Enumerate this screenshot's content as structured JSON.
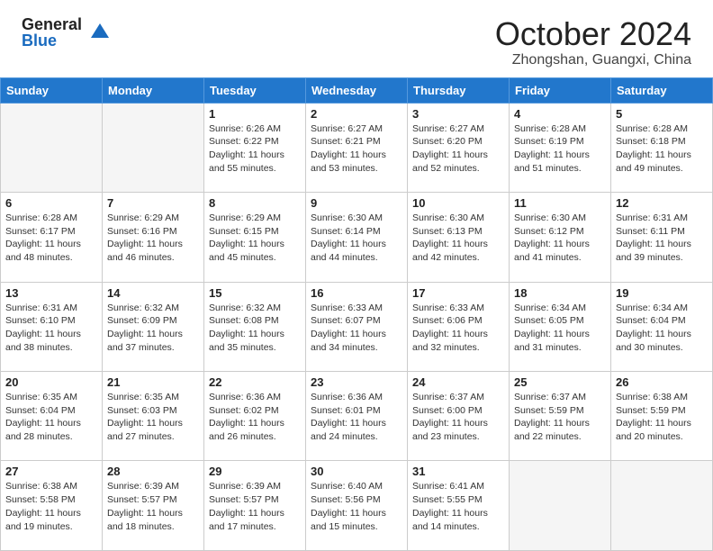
{
  "logo": {
    "general": "General",
    "blue": "Blue"
  },
  "header": {
    "month": "October 2024",
    "location": "Zhongshan, Guangxi, China"
  },
  "weekdays": [
    "Sunday",
    "Monday",
    "Tuesday",
    "Wednesday",
    "Thursday",
    "Friday",
    "Saturday"
  ],
  "weeks": [
    [
      {
        "day": "",
        "sunrise": "",
        "sunset": "",
        "daylight": ""
      },
      {
        "day": "",
        "sunrise": "",
        "sunset": "",
        "daylight": ""
      },
      {
        "day": "1",
        "sunrise": "Sunrise: 6:26 AM",
        "sunset": "Sunset: 6:22 PM",
        "daylight": "Daylight: 11 hours and 55 minutes."
      },
      {
        "day": "2",
        "sunrise": "Sunrise: 6:27 AM",
        "sunset": "Sunset: 6:21 PM",
        "daylight": "Daylight: 11 hours and 53 minutes."
      },
      {
        "day": "3",
        "sunrise": "Sunrise: 6:27 AM",
        "sunset": "Sunset: 6:20 PM",
        "daylight": "Daylight: 11 hours and 52 minutes."
      },
      {
        "day": "4",
        "sunrise": "Sunrise: 6:28 AM",
        "sunset": "Sunset: 6:19 PM",
        "daylight": "Daylight: 11 hours and 51 minutes."
      },
      {
        "day": "5",
        "sunrise": "Sunrise: 6:28 AM",
        "sunset": "Sunset: 6:18 PM",
        "daylight": "Daylight: 11 hours and 49 minutes."
      }
    ],
    [
      {
        "day": "6",
        "sunrise": "Sunrise: 6:28 AM",
        "sunset": "Sunset: 6:17 PM",
        "daylight": "Daylight: 11 hours and 48 minutes."
      },
      {
        "day": "7",
        "sunrise": "Sunrise: 6:29 AM",
        "sunset": "Sunset: 6:16 PM",
        "daylight": "Daylight: 11 hours and 46 minutes."
      },
      {
        "day": "8",
        "sunrise": "Sunrise: 6:29 AM",
        "sunset": "Sunset: 6:15 PM",
        "daylight": "Daylight: 11 hours and 45 minutes."
      },
      {
        "day": "9",
        "sunrise": "Sunrise: 6:30 AM",
        "sunset": "Sunset: 6:14 PM",
        "daylight": "Daylight: 11 hours and 44 minutes."
      },
      {
        "day": "10",
        "sunrise": "Sunrise: 6:30 AM",
        "sunset": "Sunset: 6:13 PM",
        "daylight": "Daylight: 11 hours and 42 minutes."
      },
      {
        "day": "11",
        "sunrise": "Sunrise: 6:30 AM",
        "sunset": "Sunset: 6:12 PM",
        "daylight": "Daylight: 11 hours and 41 minutes."
      },
      {
        "day": "12",
        "sunrise": "Sunrise: 6:31 AM",
        "sunset": "Sunset: 6:11 PM",
        "daylight": "Daylight: 11 hours and 39 minutes."
      }
    ],
    [
      {
        "day": "13",
        "sunrise": "Sunrise: 6:31 AM",
        "sunset": "Sunset: 6:10 PM",
        "daylight": "Daylight: 11 hours and 38 minutes."
      },
      {
        "day": "14",
        "sunrise": "Sunrise: 6:32 AM",
        "sunset": "Sunset: 6:09 PM",
        "daylight": "Daylight: 11 hours and 37 minutes."
      },
      {
        "day": "15",
        "sunrise": "Sunrise: 6:32 AM",
        "sunset": "Sunset: 6:08 PM",
        "daylight": "Daylight: 11 hours and 35 minutes."
      },
      {
        "day": "16",
        "sunrise": "Sunrise: 6:33 AM",
        "sunset": "Sunset: 6:07 PM",
        "daylight": "Daylight: 11 hours and 34 minutes."
      },
      {
        "day": "17",
        "sunrise": "Sunrise: 6:33 AM",
        "sunset": "Sunset: 6:06 PM",
        "daylight": "Daylight: 11 hours and 32 minutes."
      },
      {
        "day": "18",
        "sunrise": "Sunrise: 6:34 AM",
        "sunset": "Sunset: 6:05 PM",
        "daylight": "Daylight: 11 hours and 31 minutes."
      },
      {
        "day": "19",
        "sunrise": "Sunrise: 6:34 AM",
        "sunset": "Sunset: 6:04 PM",
        "daylight": "Daylight: 11 hours and 30 minutes."
      }
    ],
    [
      {
        "day": "20",
        "sunrise": "Sunrise: 6:35 AM",
        "sunset": "Sunset: 6:04 PM",
        "daylight": "Daylight: 11 hours and 28 minutes."
      },
      {
        "day": "21",
        "sunrise": "Sunrise: 6:35 AM",
        "sunset": "Sunset: 6:03 PM",
        "daylight": "Daylight: 11 hours and 27 minutes."
      },
      {
        "day": "22",
        "sunrise": "Sunrise: 6:36 AM",
        "sunset": "Sunset: 6:02 PM",
        "daylight": "Daylight: 11 hours and 26 minutes."
      },
      {
        "day": "23",
        "sunrise": "Sunrise: 6:36 AM",
        "sunset": "Sunset: 6:01 PM",
        "daylight": "Daylight: 11 hours and 24 minutes."
      },
      {
        "day": "24",
        "sunrise": "Sunrise: 6:37 AM",
        "sunset": "Sunset: 6:00 PM",
        "daylight": "Daylight: 11 hours and 23 minutes."
      },
      {
        "day": "25",
        "sunrise": "Sunrise: 6:37 AM",
        "sunset": "Sunset: 5:59 PM",
        "daylight": "Daylight: 11 hours and 22 minutes."
      },
      {
        "day": "26",
        "sunrise": "Sunrise: 6:38 AM",
        "sunset": "Sunset: 5:59 PM",
        "daylight": "Daylight: 11 hours and 20 minutes."
      }
    ],
    [
      {
        "day": "27",
        "sunrise": "Sunrise: 6:38 AM",
        "sunset": "Sunset: 5:58 PM",
        "daylight": "Daylight: 11 hours and 19 minutes."
      },
      {
        "day": "28",
        "sunrise": "Sunrise: 6:39 AM",
        "sunset": "Sunset: 5:57 PM",
        "daylight": "Daylight: 11 hours and 18 minutes."
      },
      {
        "day": "29",
        "sunrise": "Sunrise: 6:39 AM",
        "sunset": "Sunset: 5:57 PM",
        "daylight": "Daylight: 11 hours and 17 minutes."
      },
      {
        "day": "30",
        "sunrise": "Sunrise: 6:40 AM",
        "sunset": "Sunset: 5:56 PM",
        "daylight": "Daylight: 11 hours and 15 minutes."
      },
      {
        "day": "31",
        "sunrise": "Sunrise: 6:41 AM",
        "sunset": "Sunset: 5:55 PM",
        "daylight": "Daylight: 11 hours and 14 minutes."
      },
      {
        "day": "",
        "sunrise": "",
        "sunset": "",
        "daylight": ""
      },
      {
        "day": "",
        "sunrise": "",
        "sunset": "",
        "daylight": ""
      }
    ]
  ]
}
